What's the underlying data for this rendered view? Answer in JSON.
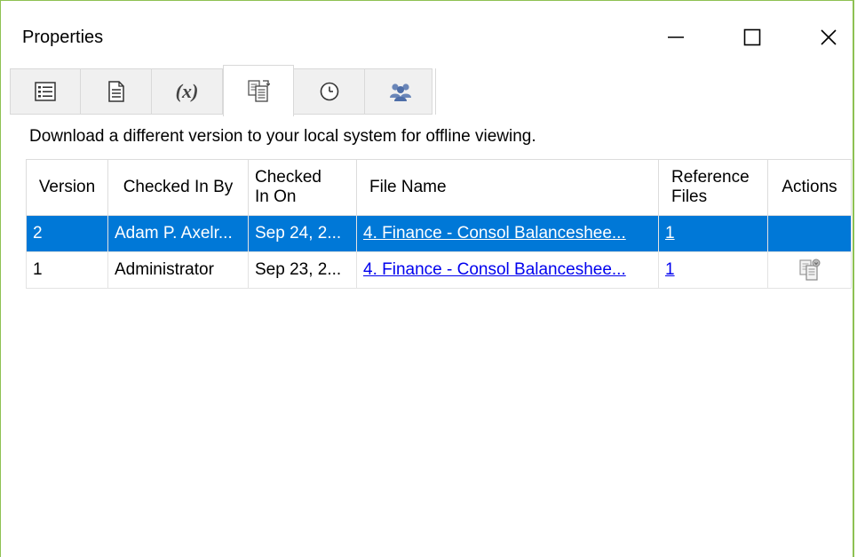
{
  "window": {
    "title": "Properties",
    "controls": [
      {
        "name": "minimize-button",
        "icon": "minimize-icon"
      },
      {
        "name": "maximize-button",
        "icon": "maximize-icon"
      },
      {
        "name": "close-button",
        "icon": "close-icon"
      }
    ],
    "accent_border": "#8ec153"
  },
  "tabs": [
    {
      "name": "tab-details",
      "icon": "list-icon",
      "active": false
    },
    {
      "name": "tab-document",
      "icon": "document-icon",
      "active": false
    },
    {
      "name": "tab-variables",
      "icon": "fx-icon",
      "label": "(x)",
      "active": false
    },
    {
      "name": "tab-versions",
      "icon": "versions-icon",
      "active": true
    },
    {
      "name": "tab-history",
      "icon": "clock-icon",
      "active": false
    },
    {
      "name": "tab-users",
      "icon": "users-icon",
      "active": false
    }
  ],
  "description": "Download a different version to your local system for offline viewing.",
  "table": {
    "headers": {
      "version": "Version",
      "checked_in_by": "Checked In By",
      "checked_in_on_1": "Checked",
      "checked_in_on_2": "In On",
      "file_name": "File Name",
      "reference_files_1": "Reference",
      "reference_files_2": "Files",
      "actions": "Actions"
    },
    "rows": [
      {
        "version": "2",
        "checked_in_by": "Adam P. Axelr...",
        "checked_in_on": "Sep 24, 2...",
        "file_name": "4. Finance - Consol Balancesheе...",
        "reference_files": "1",
        "selected": true,
        "action_icon": ""
      },
      {
        "version": "1",
        "checked_in_by": "Administrator",
        "checked_in_on": "Sep 23, 2...",
        "file_name": "4. Finance - Consol Balancesheе...",
        "reference_files": "1",
        "selected": false,
        "action_icon": "download-version-icon"
      }
    ]
  },
  "colors": {
    "selection": "#0078d7",
    "link": "#0000ee"
  }
}
